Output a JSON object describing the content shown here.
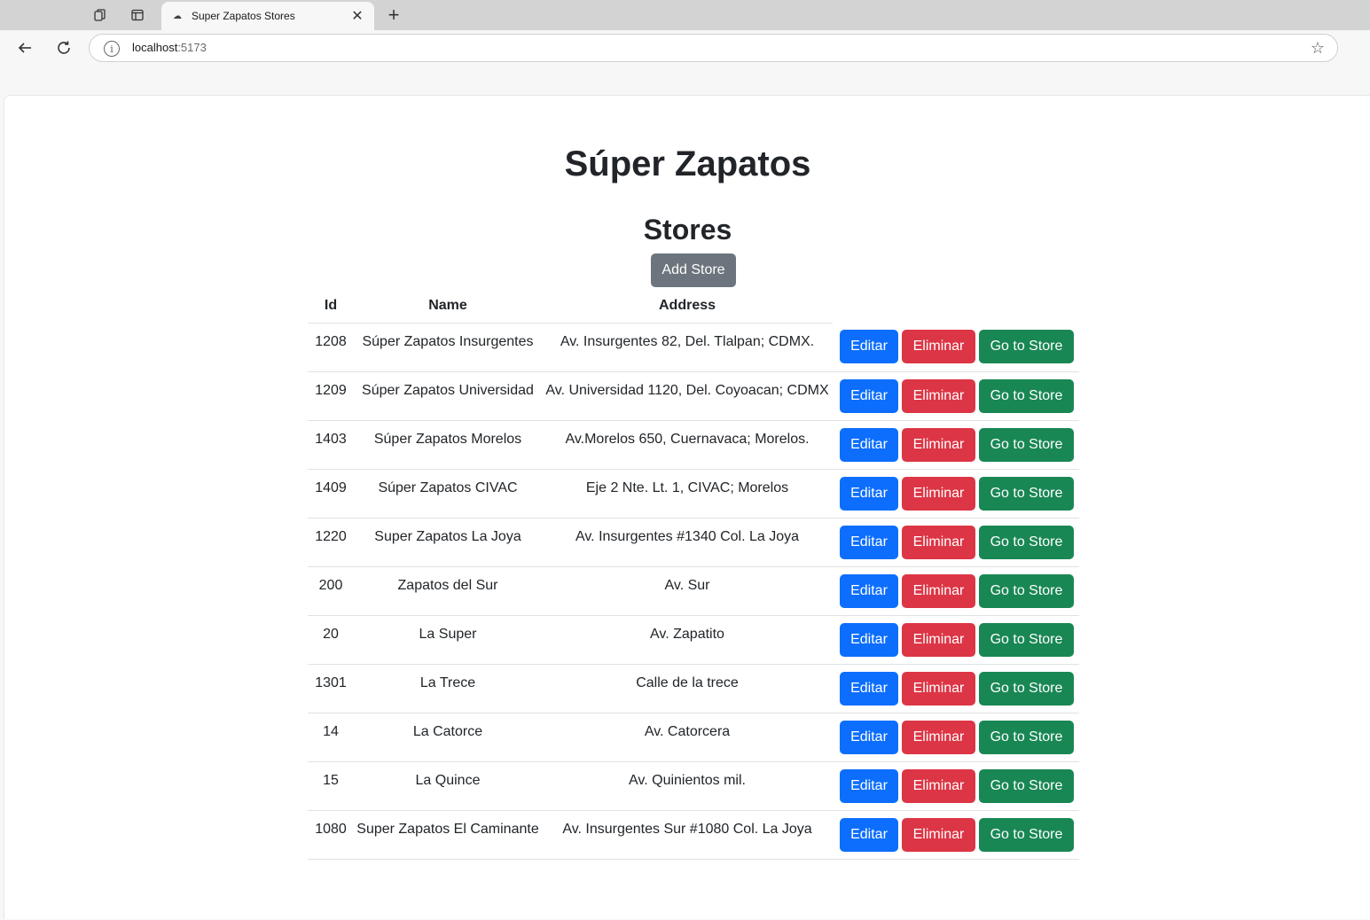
{
  "browser": {
    "tab_title": "Super Zapatos Stores",
    "url_host": "localhost",
    "url_port": ":5173"
  },
  "page": {
    "title": "Súper Zapatos",
    "subtitle": "Stores",
    "add_button": "Add Store"
  },
  "table": {
    "headers": {
      "id": "Id",
      "name": "Name",
      "address": "Address"
    },
    "actions": {
      "edit": "Editar",
      "delete": "Eliminar",
      "go": "Go to Store"
    },
    "rows": [
      {
        "id": "1208",
        "name": "Súper Zapatos Insurgentes",
        "address": "Av. Insurgentes 82, Del. Tlalpan; CDMX."
      },
      {
        "id": "1209",
        "name": "Súper Zapatos Universidad",
        "address": "Av. Universidad 1120, Del. Coyoacan; CDMX"
      },
      {
        "id": "1403",
        "name": "Súper Zapatos Morelos",
        "address": "Av.Morelos 650, Cuernavaca; Morelos."
      },
      {
        "id": "1409",
        "name": "Súper Zapatos CIVAC",
        "address": "Eje 2 Nte. Lt. 1, CIVAC; Morelos"
      },
      {
        "id": "1220",
        "name": "Super Zapatos La Joya",
        "address": "Av. Insurgentes #1340 Col. La Joya"
      },
      {
        "id": "200",
        "name": "Zapatos del Sur",
        "address": "Av. Sur"
      },
      {
        "id": "20",
        "name": "La Super",
        "address": "Av. Zapatito"
      },
      {
        "id": "1301",
        "name": "La Trece",
        "address": "Calle de la trece"
      },
      {
        "id": "14",
        "name": "La Catorce",
        "address": "Av. Catorcera"
      },
      {
        "id": "15",
        "name": "La Quince",
        "address": "Av. Quinientos mil."
      },
      {
        "id": "1080",
        "name": "Super Zapatos El Caminante",
        "address": "Av. Insurgentes Sur #1080 Col. La Joya"
      }
    ]
  },
  "colors": {
    "edit": "#0d6efd",
    "delete": "#dc3545",
    "go": "#198754",
    "add": "#6c757d"
  }
}
